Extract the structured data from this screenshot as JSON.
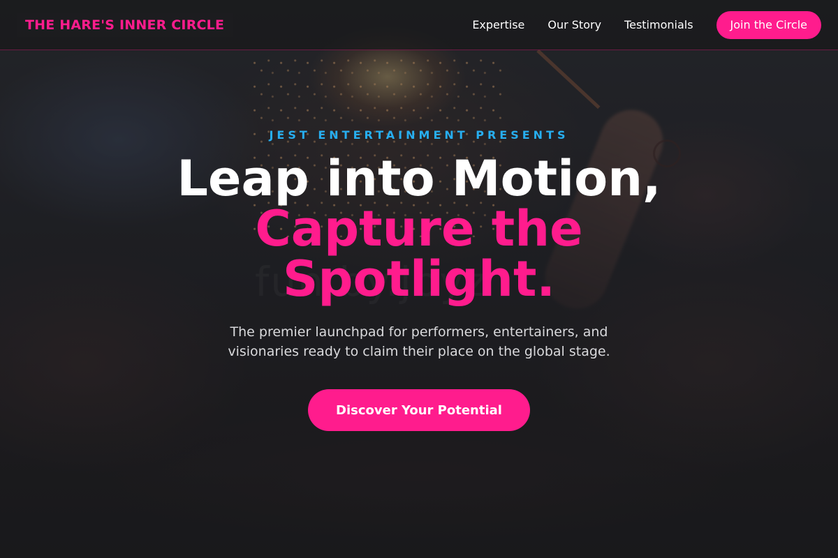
{
  "header": {
    "logo_text": "THE HARE'S INNER CIRCLE",
    "nav": [
      {
        "label": "Expertise"
      },
      {
        "label": "Our Story"
      },
      {
        "label": "Testimonials"
      }
    ],
    "cta_label": "Join the Circle"
  },
  "hero": {
    "eyebrow": "JEST ENTERTAINMENT PRESENTS",
    "headline_line1": "Leap into Motion,",
    "headline_line2": "Capture the",
    "headline_line3": "Spotlight.",
    "subtitle": "The premier launchpad for performers, entertainers, and visionaries ready to claim their place on the global stage.",
    "cta_label": "Discover Your Potential",
    "watermark_text": "fun.by.jbyz"
  },
  "colors": {
    "accent": "#ff1c8d",
    "eyebrow": "#27aef0",
    "background": "#1b1b1d",
    "text": "#ffffff"
  }
}
